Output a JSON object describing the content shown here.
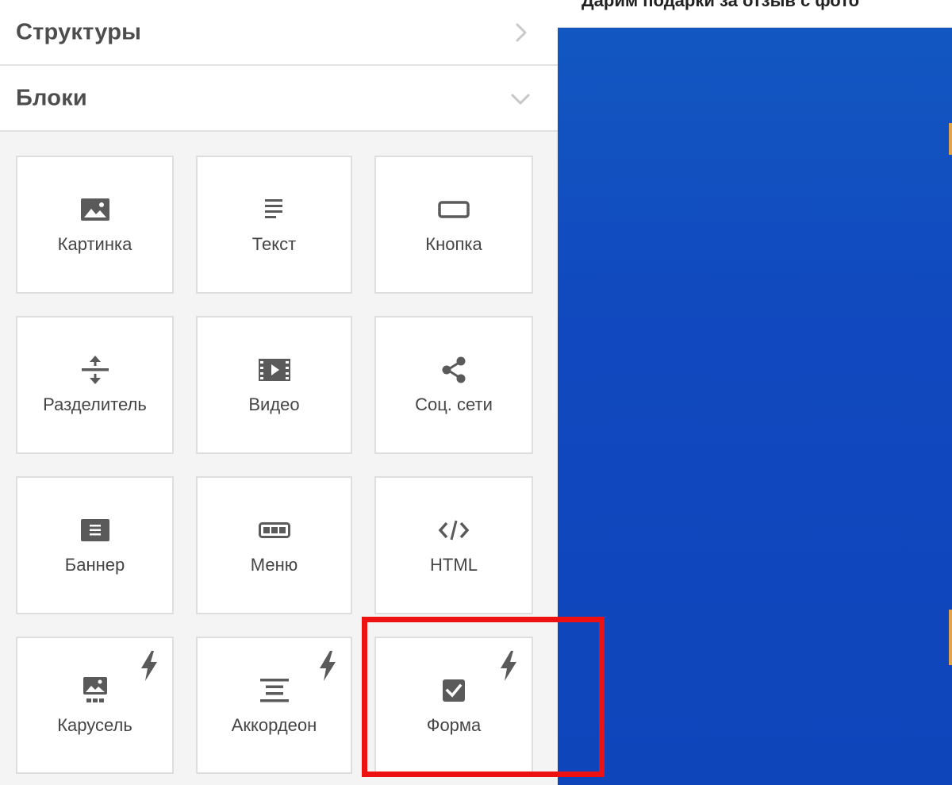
{
  "panel": {
    "structures": {
      "title": "Структуры"
    },
    "blocks": {
      "title": "Блоки"
    }
  },
  "tiles": [
    {
      "label": "Картинка",
      "icon": "image-icon",
      "bolt": false
    },
    {
      "label": "Текст",
      "icon": "text-lines-icon",
      "bolt": false
    },
    {
      "label": "Кнопка",
      "icon": "button-icon",
      "bolt": false
    },
    {
      "label": "Разделитель",
      "icon": "divider-icon",
      "bolt": false
    },
    {
      "label": "Видео",
      "icon": "video-icon",
      "bolt": false
    },
    {
      "label": "Соц. сети",
      "icon": "share-icon",
      "bolt": false
    },
    {
      "label": "Баннер",
      "icon": "banner-icon",
      "bolt": false
    },
    {
      "label": "Меню",
      "icon": "menu-icon",
      "bolt": false
    },
    {
      "label": "HTML",
      "icon": "code-icon",
      "bolt": false
    },
    {
      "label": "Карусель",
      "icon": "carousel-icon",
      "bolt": true
    },
    {
      "label": "Аккордеон",
      "icon": "accordion-icon",
      "bolt": true
    },
    {
      "label": "Форма",
      "icon": "checkbox-icon",
      "bolt": true
    }
  ],
  "preview": {
    "top_text": "Дарим подарки за отзыв с фото"
  },
  "colors": {
    "panel_bg": "#f4f4f4",
    "icon": "#5a5a5a",
    "preview_blue": "#1148bf",
    "highlight": "#ee1111"
  }
}
